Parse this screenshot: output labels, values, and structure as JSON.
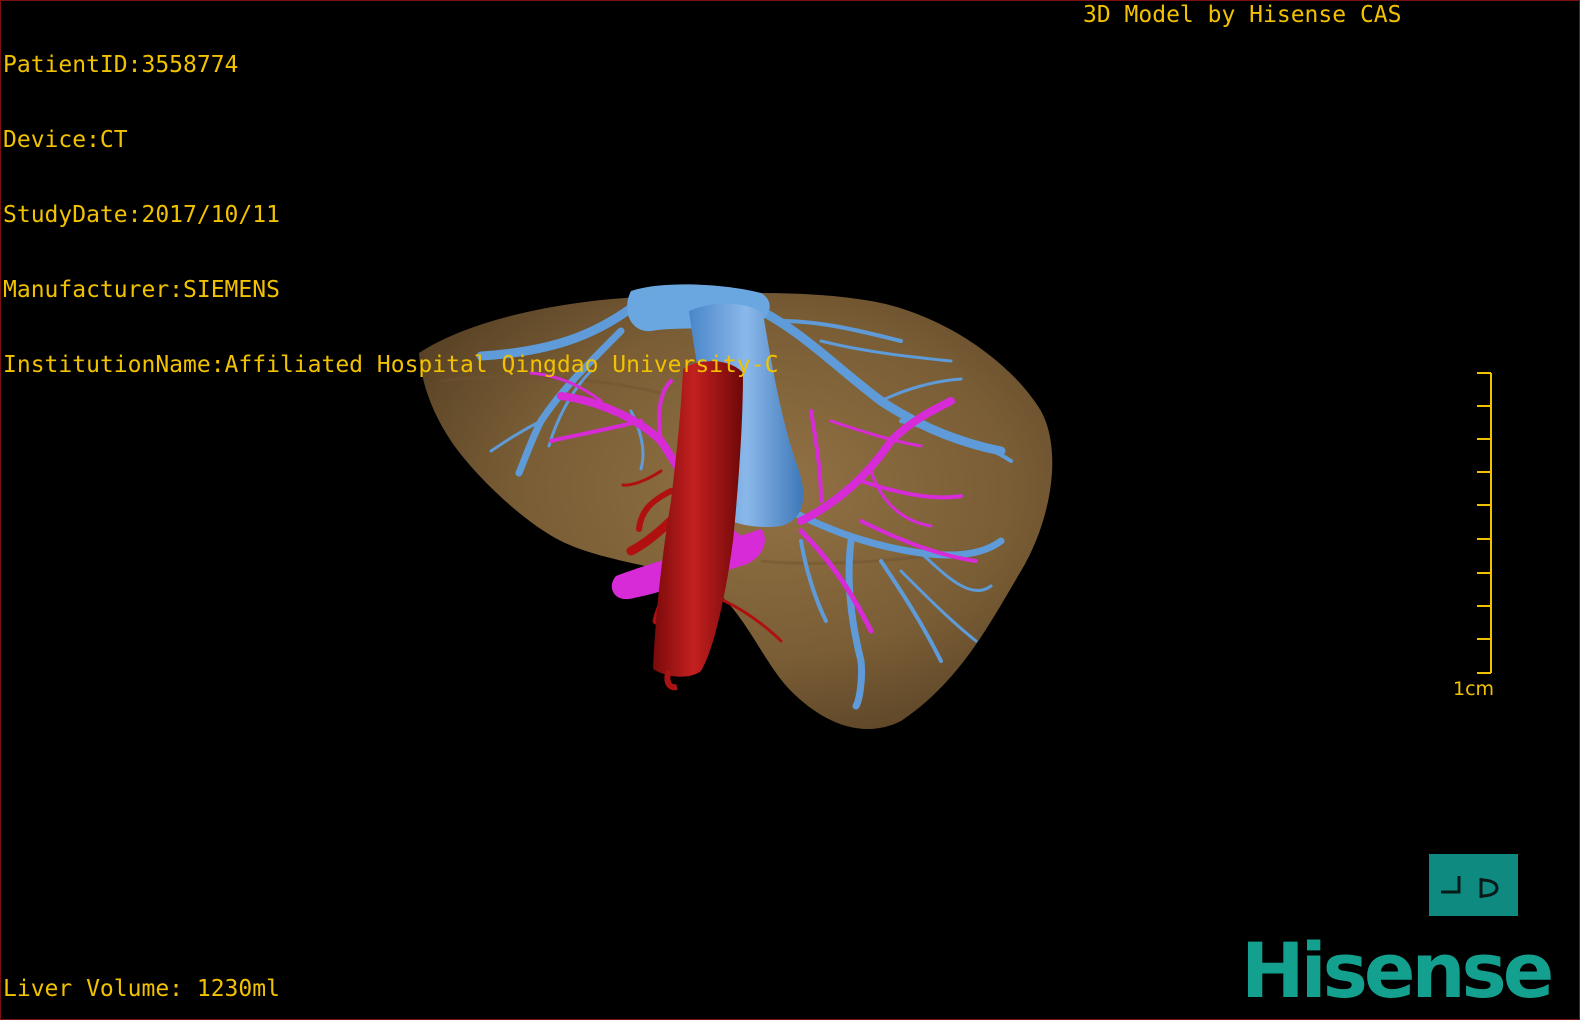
{
  "info": {
    "patient": "PatientID:3558774",
    "device": "Device:CT",
    "study_date": "StudyDate:2017/10/11",
    "manufacturer": "Manufacturer:SIEMENS",
    "institution": "InstitutionName:Affiliated Hospital Qingdao University-C"
  },
  "credit": "3D Model by Hisense CAS",
  "liver_volume": "Liver Volume: 1230ml",
  "scale_bar": {
    "label": "1cm"
  },
  "view_button": {
    "icon": "orientation-icon"
  },
  "brand": {
    "logo_text": "Hisense"
  },
  "colors": {
    "overlay_text": "#f2c200",
    "liver": "#8a6a3c",
    "hepatic_vein": "#5e9bd8",
    "portal_vein": "#d62bd6",
    "artery": "#a81414",
    "brand": "#14a08e"
  }
}
